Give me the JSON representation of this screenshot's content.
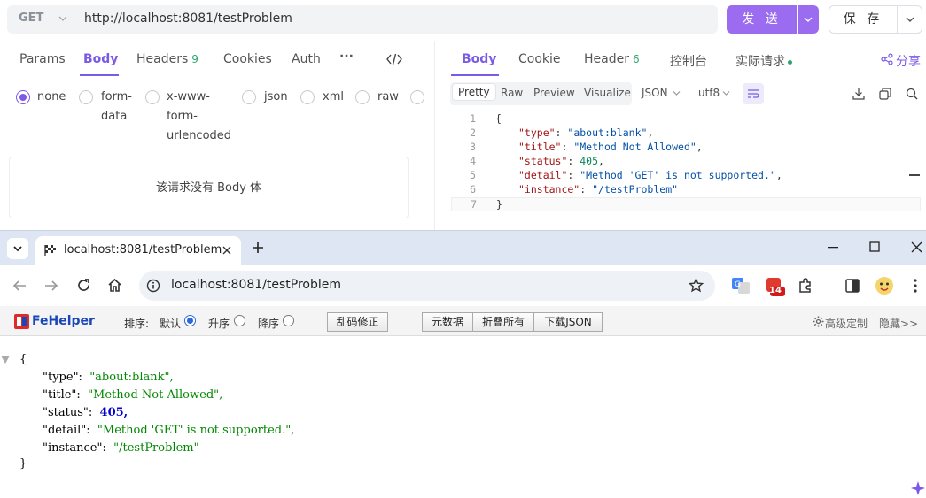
{
  "request": {
    "method": "GET",
    "url": "http://localhost:8081/testProblem",
    "send_label": "发 送",
    "save_label": "保 存"
  },
  "request_tabs": [
    {
      "label": "Params"
    },
    {
      "label": "Body"
    },
    {
      "label": "Headers"
    },
    {
      "label": "Cookies"
    },
    {
      "label": "Auth"
    },
    {
      "label": "···"
    }
  ],
  "request_headers_count": "9",
  "body_types": [
    {
      "label": "none",
      "checked": true
    },
    {
      "label": "form-\ndata"
    },
    {
      "label": "x-www-\nform-\nurlencoded"
    },
    {
      "label": "json"
    },
    {
      "label": "xml"
    },
    {
      "label": "raw"
    }
  ],
  "body_types_text": {
    "none": "none",
    "form1": "form-",
    "form2": "data",
    "x1": "x-www-",
    "x2": "form-",
    "x3": "urlencoded",
    "json": "json",
    "xml": "xml",
    "raw": "raw"
  },
  "no_body_text": "该请求没有 Body 体",
  "response_tabs": {
    "body": "Body",
    "cookie": "Cookie",
    "header": "Header",
    "header_count": "6",
    "console": "控制台",
    "actual_request": "实际请求",
    "share": "分享"
  },
  "format_bar": {
    "pretty": "Pretty",
    "raw": "Raw",
    "preview": "Preview",
    "visualize": "Visualize",
    "lang": "JSON",
    "encoding": "utf8"
  },
  "response_code": [
    "{",
    "    \"type\": \"about:blank\",",
    "    \"title\": \"Method Not Allowed\",",
    "    \"status\": 405,",
    "    \"detail\": \"Method 'GET' is not supported.\",",
    "    \"instance\": \"/testProblem\"",
    "}"
  ],
  "response_code_parts": {
    "l1": "{",
    "l2k": "\"type\"",
    "l2v": "\"about:blank\"",
    "l3k": "\"title\"",
    "l3v": "\"Method Not Allowed\"",
    "l4k": "\"status\"",
    "l4v": "405",
    "l5k": "\"detail\"",
    "l5v": "\"Method 'GET' is not supported.\"",
    "l6k": "\"instance\"",
    "l6v": "\"/testProblem\"",
    "l7": "}"
  },
  "line_numbers": [
    "1",
    "2",
    "3",
    "4",
    "5",
    "6",
    "7"
  ],
  "browser": {
    "tab_title": "localhost:8081/testProblem",
    "address": "localhost:8081/testProblem",
    "extension_badge": "14"
  },
  "fehelper": {
    "name": "FeHelper",
    "sort_label": "排序:",
    "default_label": "默认",
    "asc_label": "升序",
    "desc_label": "降序",
    "fix_button": "乱码修正",
    "meta_button": "元数据",
    "collapse_button": "折叠所有",
    "download_button": "下载JSON",
    "advanced": "高级定制",
    "hide": "隐藏>>"
  },
  "json_view": {
    "open": "{",
    "k1": "\"type\":",
    "v1": "\"about:blank\",",
    "k2": "\"title\":",
    "v2": "\"Method Not Allowed\",",
    "k3": "\"status\":",
    "v3": "405,",
    "k4": "\"detail\":",
    "v4": "\"Method 'GET' is not supported.\",",
    "k5": "\"instance\":",
    "v5": "\"/testProblem\"",
    "close": "}"
  },
  "colors": {
    "accent": "#7b5ae6",
    "send": "#9b6cf0",
    "count_green": "#2ea56f"
  }
}
